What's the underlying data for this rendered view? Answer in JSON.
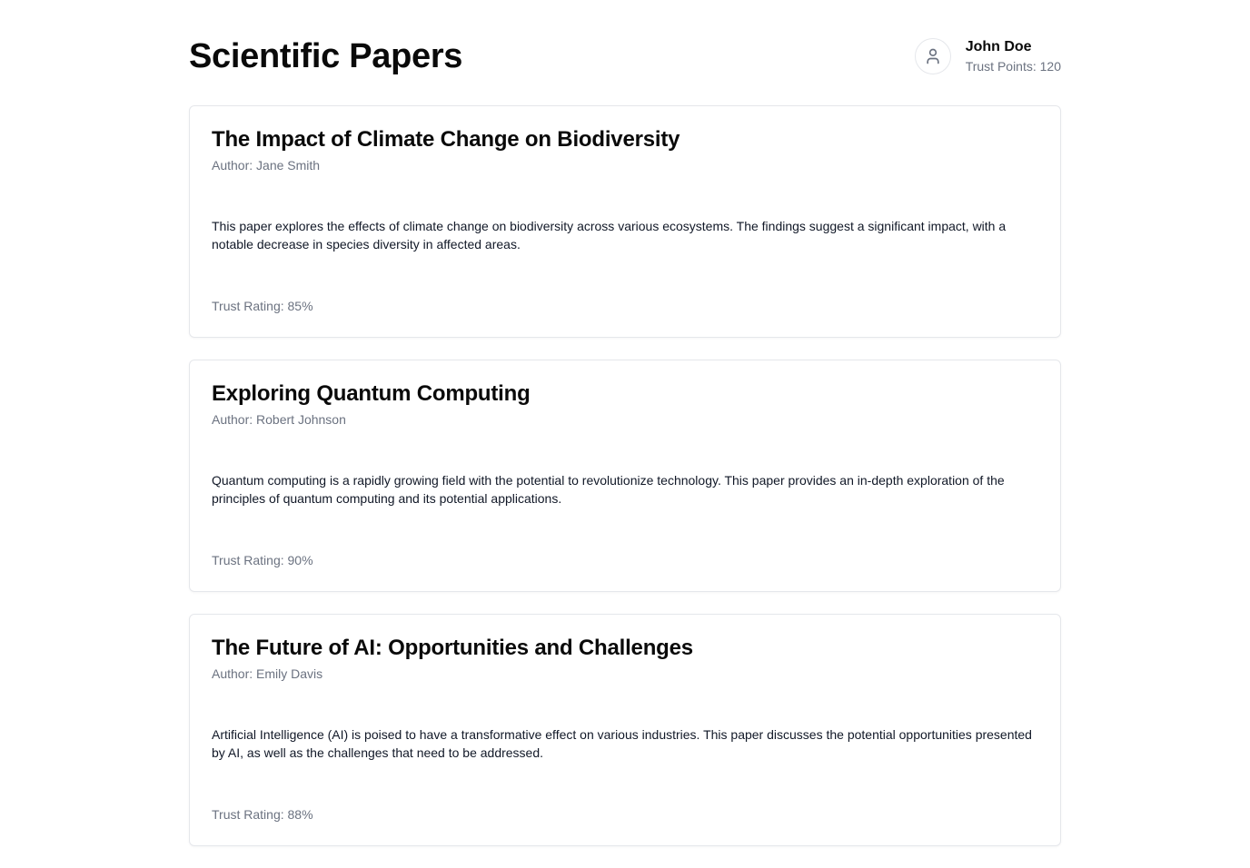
{
  "header": {
    "title": "Scientific Papers"
  },
  "user": {
    "avatar_icon": "user-icon",
    "name": "John Doe",
    "trust_points": "Trust Points: 120"
  },
  "papers": [
    {
      "title": "The Impact of Climate Change on Biodiversity",
      "author": "Author: Jane Smith",
      "abstract": "This paper explores the effects of climate change on biodiversity across various ecosystems. The findings suggest a significant impact, with a notable decrease in species diversity in affected areas.",
      "trust_rating": "Trust Rating: 85%"
    },
    {
      "title": "Exploring Quantum Computing",
      "author": "Author: Robert Johnson",
      "abstract": "Quantum computing is a rapidly growing field with the potential to revolutionize technology. This paper provides an in-depth exploration of the principles of quantum computing and its potential applications.",
      "trust_rating": "Trust Rating: 90%"
    },
    {
      "title": "The Future of AI: Opportunities and Challenges",
      "author": "Author: Emily Davis",
      "abstract": "Artificial Intelligence (AI) is poised to have a transformative effect on various industries. This paper discusses the potential opportunities presented by AI, as well as the challenges that need to be addressed.",
      "trust_rating": "Trust Rating: 88%"
    }
  ],
  "colors": {
    "text": "#0a0a0a",
    "muted": "#6b7280",
    "border": "#e5e7eb"
  }
}
